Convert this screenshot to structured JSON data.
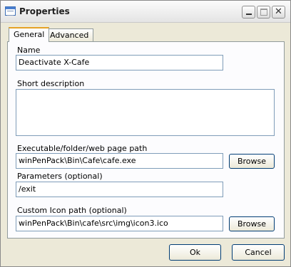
{
  "window": {
    "title": "Properties",
    "icon": "properties-icon",
    "close_glyph": "✕"
  },
  "tabs": [
    {
      "label": "General",
      "selected": true
    },
    {
      "label": "Advanced",
      "selected": false
    }
  ],
  "general": {
    "name_label": "Name",
    "name_value": "Deactivate X-Cafe",
    "short_description_label": "Short description",
    "short_description_value": "",
    "path_label": "Executable/folder/web page path",
    "path_value": "winPenPack\\Bin\\Cafe\\cafe.exe",
    "parameters_label": "Parameters (optional)",
    "parameters_value": "/exit",
    "custom_icon_label": "Custom Icon path (optional)",
    "custom_icon_value": "winPenPack\\Bin\\cafe\\src\\img\\icon3.ico",
    "browse_label": "Browse"
  },
  "footer": {
    "ok_label": "Ok",
    "cancel_label": "Cancel"
  }
}
